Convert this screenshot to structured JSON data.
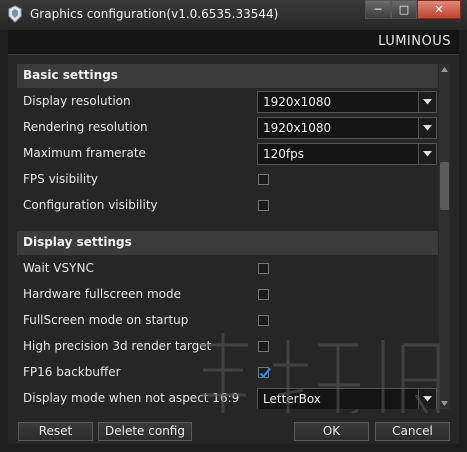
{
  "window": {
    "title": "Graphics configuration(v1.0.6535.33544)",
    "controls": {
      "minimize": "─",
      "maximize": "□",
      "close": "✕"
    }
  },
  "brand": "LUMINOUS",
  "sections": {
    "basic": {
      "title": "Basic settings"
    },
    "display": {
      "title": "Display settings"
    }
  },
  "settings": {
    "display_resolution": {
      "label": "Display resolution",
      "value": "1920x1080"
    },
    "rendering_resolution": {
      "label": "Rendering resolution",
      "value": "1920x1080"
    },
    "max_framerate": {
      "label": "Maximum framerate",
      "value": "120fps"
    },
    "fps_visibility": {
      "label": "FPS visibility",
      "checked": false
    },
    "config_visibility": {
      "label": "Configuration visibility",
      "checked": false
    },
    "wait_vsync": {
      "label": "Wait VSYNC",
      "checked": false
    },
    "hw_fullscreen": {
      "label": "Hardware fullscreen mode",
      "checked": false
    },
    "fullscreen_startup": {
      "label": "FullScreen mode on startup",
      "checked": false
    },
    "high_precision_rt": {
      "label": "High precision 3d render target",
      "checked": false
    },
    "fp16_backbuffer": {
      "label": "FP16 backbuffer",
      "checked": true
    },
    "display_mode_aspect": {
      "label": "Display mode when not aspect 16:9",
      "value": "LetterBox"
    }
  },
  "buttons": {
    "reset": "Reset",
    "delete_config": "Delete config",
    "ok": "OK",
    "cancel": "Cancel"
  },
  "colors": {
    "check_accent": "#2a8cff",
    "close_button": "#c0432e"
  },
  "icons": {
    "app": "app-logo-icon",
    "dropdown": "chevron-down-icon",
    "check": "checkmark-icon"
  }
}
